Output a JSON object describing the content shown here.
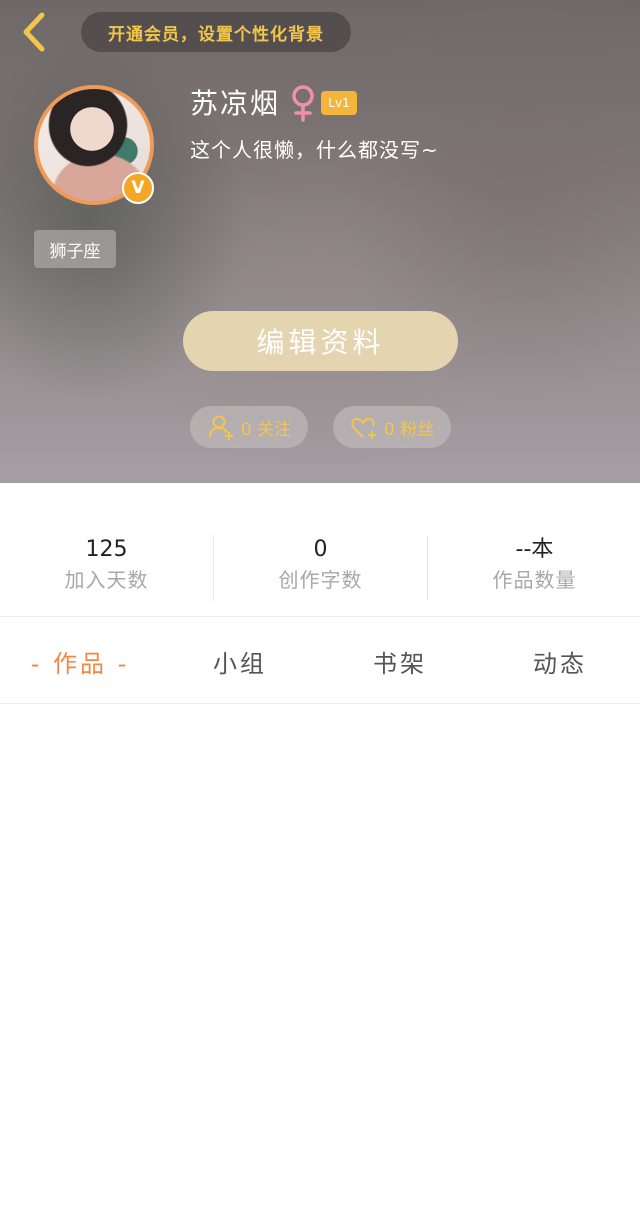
{
  "header": {
    "vip_banner": "开通会员，设置个性化背景",
    "username": "苏凉烟",
    "level": "Lv1",
    "bio": "这个人很懒，什么都没写~",
    "zodiac": "狮子座",
    "avatar_badge": "V",
    "edit_button": "编辑资料",
    "follow_label": "0 关注",
    "fans_label": "0 粉丝"
  },
  "stats": [
    {
      "value": "125",
      "label": "加入天数"
    },
    {
      "value": "0",
      "label": "创作字数"
    },
    {
      "value": "--本",
      "label": "作品数量"
    }
  ],
  "tabs": [
    {
      "label": "- 作品 -",
      "active": true
    },
    {
      "label": "小组",
      "active": false
    },
    {
      "label": "书架",
      "active": false
    },
    {
      "label": "动态",
      "active": false
    }
  ],
  "colors": {
    "accent": "#ef8a46",
    "gold": "#f2c64c",
    "edit_button": "#e4d4b0",
    "gender": "#f08fb0"
  },
  "icons": {
    "back": "chevron-left-icon",
    "gender": "female-icon",
    "follow": "user-add-icon",
    "fans": "heart-add-icon"
  }
}
